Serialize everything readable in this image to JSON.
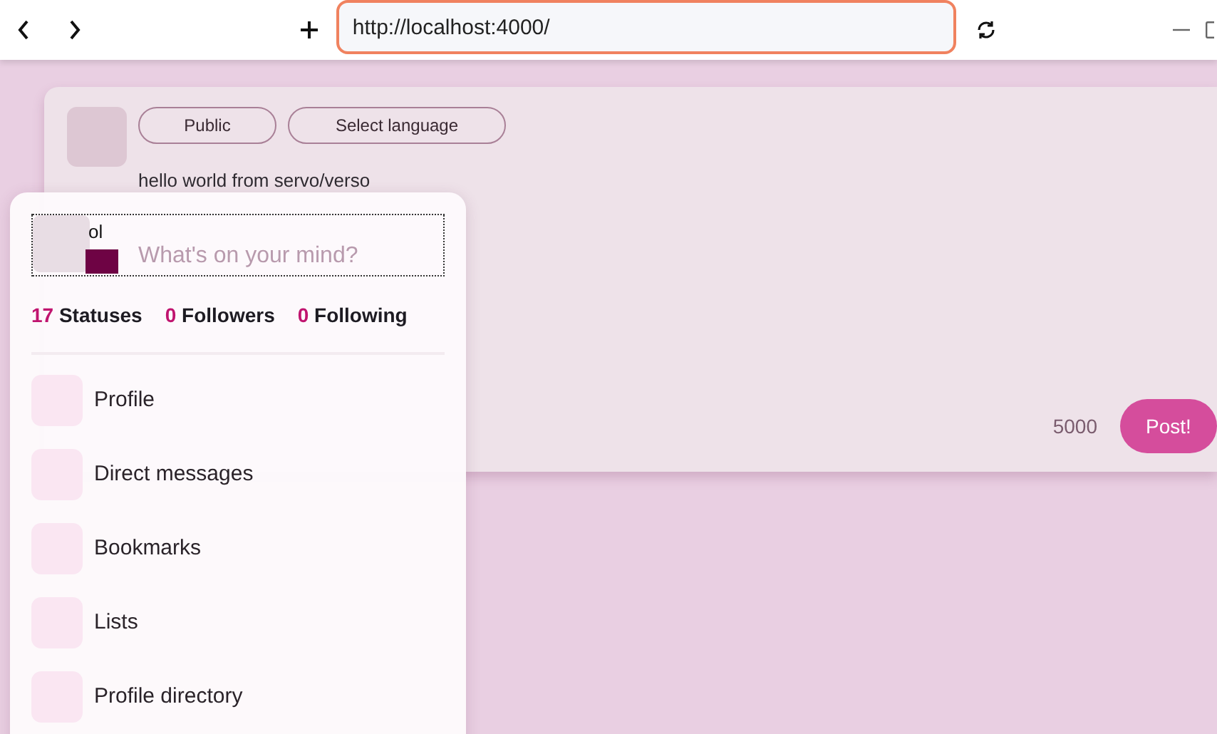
{
  "browser": {
    "url": "http://localhost:4000/"
  },
  "composer": {
    "visibility": "Public",
    "language": "Select language",
    "text": "hello world from servo/verso",
    "placeholder": "What's on your mind?",
    "char_count": "5000",
    "submit": "Post!"
  },
  "account_panel": {
    "display_name": "ol",
    "stats": [
      {
        "count": "17",
        "label": "Statuses"
      },
      {
        "count": "0",
        "label": "Followers"
      },
      {
        "count": "0",
        "label": "Following"
      }
    ],
    "menu": [
      {
        "label": "Profile"
      },
      {
        "label": "Direct messages"
      },
      {
        "label": "Bookmarks"
      },
      {
        "label": "Lists"
      },
      {
        "label": "Profile directory"
      }
    ]
  }
}
